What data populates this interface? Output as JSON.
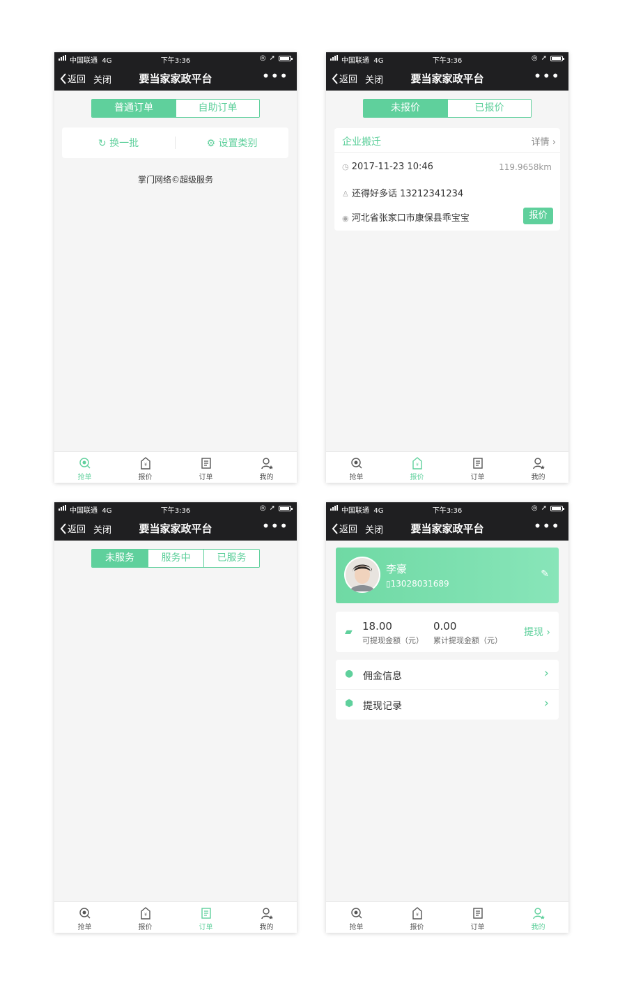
{
  "status": {
    "carrier": "中国联通",
    "network": "4G",
    "time": "下午3:36"
  },
  "nav": {
    "back": "返回",
    "close": "关闭",
    "title": "要当家家政平台",
    "more": "•••"
  },
  "tabbar": {
    "grab": "抢单",
    "quote": "报价",
    "orders": "订单",
    "mine": "我的"
  },
  "colors": {
    "accent": "#5fd09c",
    "dark_bar": "#1f1f21",
    "background": "#f5f5f5"
  },
  "screen1": {
    "tab_normal": "普通订单",
    "tab_self": "自助订单",
    "refresh": "换一批",
    "set_category": "设置类别",
    "footer": "掌门网络©超级服务"
  },
  "screen2": {
    "tab_unquoted": "未报价",
    "tab_quoted": "已报价",
    "order": {
      "type": "企业搬迁",
      "detail": "详情",
      "datetime": "2017-11-23 10:46",
      "distance": "119.9658km",
      "contact": "还得好多话 13212341234",
      "address": "河北省张家口市康保县乖宝宝",
      "quote_button": "报价"
    }
  },
  "screen3": {
    "tab_pending": "未服务",
    "tab_in_service": "服务中",
    "tab_served": "已服务"
  },
  "screen4": {
    "profile": {
      "name": "李豪",
      "phone": "13028031689"
    },
    "wallet": {
      "available": "18.00",
      "available_label": "可提现金额（元）",
      "total": "0.00",
      "total_label": "累计提现金额（元）",
      "withdraw": "提现"
    },
    "menu": [
      {
        "label": "佣金信息"
      },
      {
        "label": "提现记录"
      }
    ]
  }
}
